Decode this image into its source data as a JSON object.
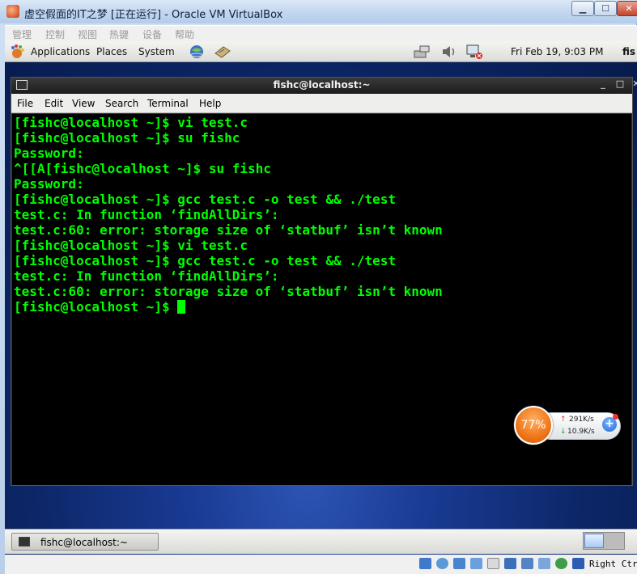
{
  "vbox": {
    "title": "虚空假面的IT之梦 [正在运行] - Oracle VM VirtualBox",
    "menu": [
      "管理",
      "控制",
      "视图",
      "热键",
      "设备",
      "帮助"
    ],
    "status_host_key": "Right Ctrl"
  },
  "gnome_top": {
    "menu": [
      "Applications",
      "Places",
      "System"
    ],
    "clock": "Fri Feb 19,  9:03 PM",
    "user_partial": "fis"
  },
  "terminal": {
    "title": "fishc@localhost:~",
    "menu": [
      "File",
      "Edit",
      "View",
      "Search",
      "Terminal",
      "Help"
    ],
    "lines": [
      "[fishc@localhost ~]$ vi test.c",
      "[fishc@localhost ~]$ su fishc",
      "Password:",
      "^[[A[fishc@localhost ~]$ su fishc",
      "Password:",
      "[fishc@localhost ~]$ gcc test.c -o test && ./test",
      "test.c: In function ‘findAllDirs’:",
      "test.c:60: error: storage size of ‘statbuf’ isn’t known",
      "[fishc@localhost ~]$ vi test.c",
      "[fishc@localhost ~]$ gcc test.c -o test && ./test",
      "test.c: In function ‘findAllDirs’:",
      "test.c:60: error: storage size of ‘statbuf’ isn’t known"
    ],
    "prompt": "[fishc@localhost ~]$"
  },
  "speed_widget": {
    "percent": "77%",
    "upload": "291K/s",
    "download": "10.9K/s"
  },
  "taskbar": {
    "window_label": "fishc@localhost:~"
  },
  "colors": {
    "terminal_fg": "#00ff00",
    "terminal_bg": "#000000",
    "desktop": "#0c2666"
  }
}
